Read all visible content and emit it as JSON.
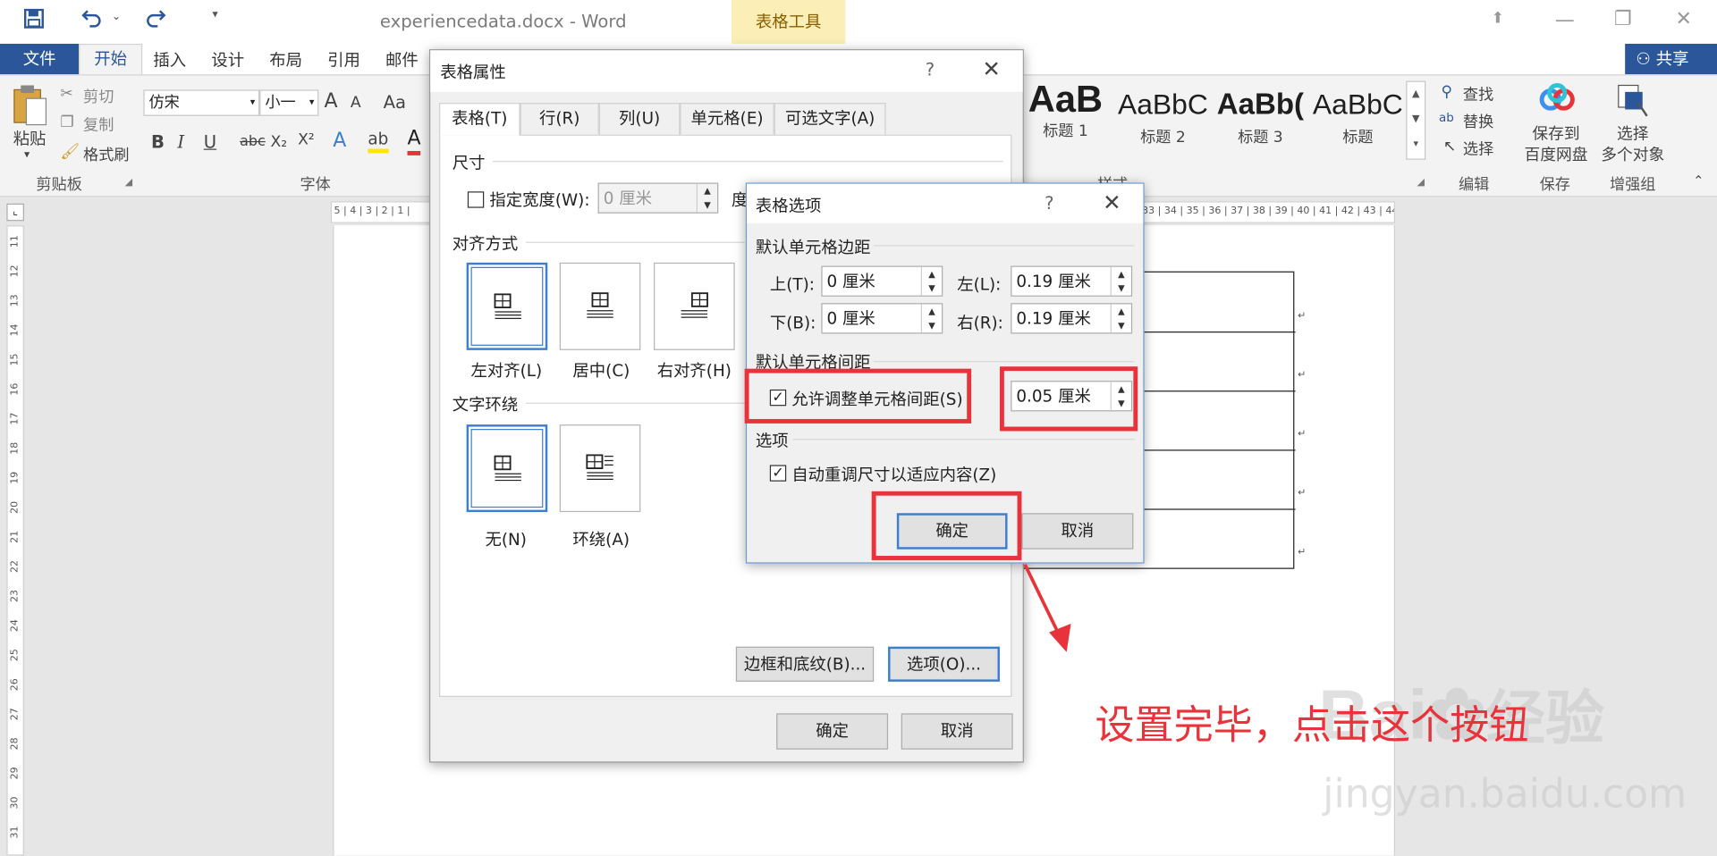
{
  "titlebar": {
    "doc_title": "experiencedata.docx - Word",
    "context_tab": "表格工具",
    "dropdown_glyph": "⌄",
    "minimize": "—",
    "restore": "❐",
    "close": "✕"
  },
  "menu": {
    "items": [
      "文件",
      "开始",
      "插入",
      "设计",
      "布局",
      "引用",
      "邮件"
    ],
    "share": "共享"
  },
  "ribbon": {
    "paste": "粘贴",
    "cut": "剪切",
    "copy": "复制",
    "format_painter": "格式刷",
    "clipboard_group": "剪贴板",
    "font_name": "仿宋",
    "font_size": "小一",
    "font_group": "字体",
    "grow": "A",
    "shrink": "A",
    "change_case": "Aa",
    "bold": "B",
    "italic": "I",
    "underline": "U",
    "strike": "abc",
    "subscript": "X₂",
    "superscript": "X²",
    "styles": [
      {
        "sample": "AaB",
        "name": "标题 1"
      },
      {
        "sample": "AaBbC",
        "name": "标题 2"
      },
      {
        "sample": "AaBb(",
        "name": "标题 3"
      },
      {
        "sample": "AaBbC",
        "name": "标题"
      }
    ],
    "styles_group": "样式",
    "find": "查找",
    "replace": "替换",
    "select": "选择",
    "editing_group": "编辑",
    "save_baidu": "保存到\n百度网盘",
    "save_group": "保存",
    "select_objects": "选择\n多个对象",
    "enhance_group": "增强组"
  },
  "ruler": {
    "horizontal": "5 | 4 | 3 | 2 | 1 |",
    "horizontal_right": "33 | 34 | 35 | 36 | 37 | 38 | 39 | 40 | 41 | 42 | 43 | 44",
    "vertical": [
      "11",
      "12",
      "13",
      "14",
      "15",
      "16",
      "17",
      "18",
      "19",
      "20",
      "21",
      "22",
      "23",
      "24",
      "25",
      "26",
      "27",
      "28",
      "29",
      "30",
      "31"
    ]
  },
  "table_props": {
    "title": "表格属性",
    "help": "?",
    "close": "✕",
    "tabs": [
      "表格(T)",
      "行(R)",
      "列(U)",
      "单元格(E)",
      "可选文字(A)"
    ],
    "size_label": "尺寸",
    "width_label": "指定宽度(W):",
    "width_value": "0 厘米",
    "measure_label": "度",
    "align_label": "对齐方式",
    "align_options": [
      "左对齐(L)",
      "居中(C)",
      "右对齐(H)"
    ],
    "wrap_label": "文字环绕",
    "wrap_options": [
      "无(N)",
      "环绕(A)"
    ],
    "borders_button": "边框和底纹(B)...",
    "options_button": "选项(O)...",
    "ok": "确定",
    "cancel": "取消"
  },
  "table_options": {
    "title": "表格选项",
    "help": "?",
    "close": "✕",
    "margins_label": "默认单元格边距",
    "top_label": "上(T):",
    "top_value": "0 厘米",
    "bottom_label": "下(B):",
    "bottom_value": "0 厘米",
    "left_label": "左(L):",
    "left_value": "0.19 厘米",
    "right_label": "右(R):",
    "right_value": "0.19 厘米",
    "spacing_label": "默认单元格间距",
    "allow_spacing": "允许调整单元格间距(S)",
    "allow_spacing_checked": "✓",
    "spacing_value": "0.05 厘米",
    "options_label": "选项",
    "autofit": "自动重调尺寸以适应内容(Z)",
    "autofit_checked": "✓",
    "ok": "确定",
    "cancel": "取消"
  },
  "annotation": {
    "text": "设置完毕，点击这个按钮",
    "color": "#e8333a"
  },
  "watermark": {
    "logo": "Bai",
    "logo_tail": "经验",
    "url": "jingyan.baidu.com"
  },
  "colors": {
    "accent": "#2b579a",
    "context_tab_bg": "#fbeeb6",
    "highlight_red": "#e8333a",
    "focus_blue": "#3c7fd0"
  }
}
